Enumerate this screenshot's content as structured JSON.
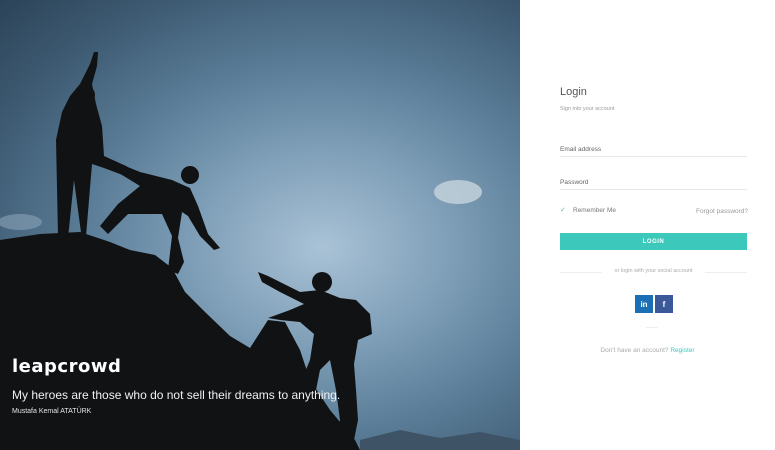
{
  "hero": {
    "brand": "leapcrowd",
    "quote": "My heroes are those who do not sell their dreams to anything.",
    "author": "Mustafa Kemal ATATÜRK"
  },
  "login": {
    "title": "Login",
    "subtitle": "Sign into your account",
    "email_placeholder": "Email address",
    "password_placeholder": "Password",
    "remember_label": "Remember Me",
    "remember_checked": true,
    "forgot_label": "Forgot password?",
    "button_label": "LOGIN",
    "divider_text": "or login with your social account",
    "social": {
      "linkedin": "in",
      "facebook": "f"
    },
    "register_prompt": "Don't have an account?",
    "register_link": "Register"
  },
  "colors": {
    "accent": "#3cc9bc",
    "linkedin": "#1a6fb5",
    "facebook": "#3b5998"
  }
}
